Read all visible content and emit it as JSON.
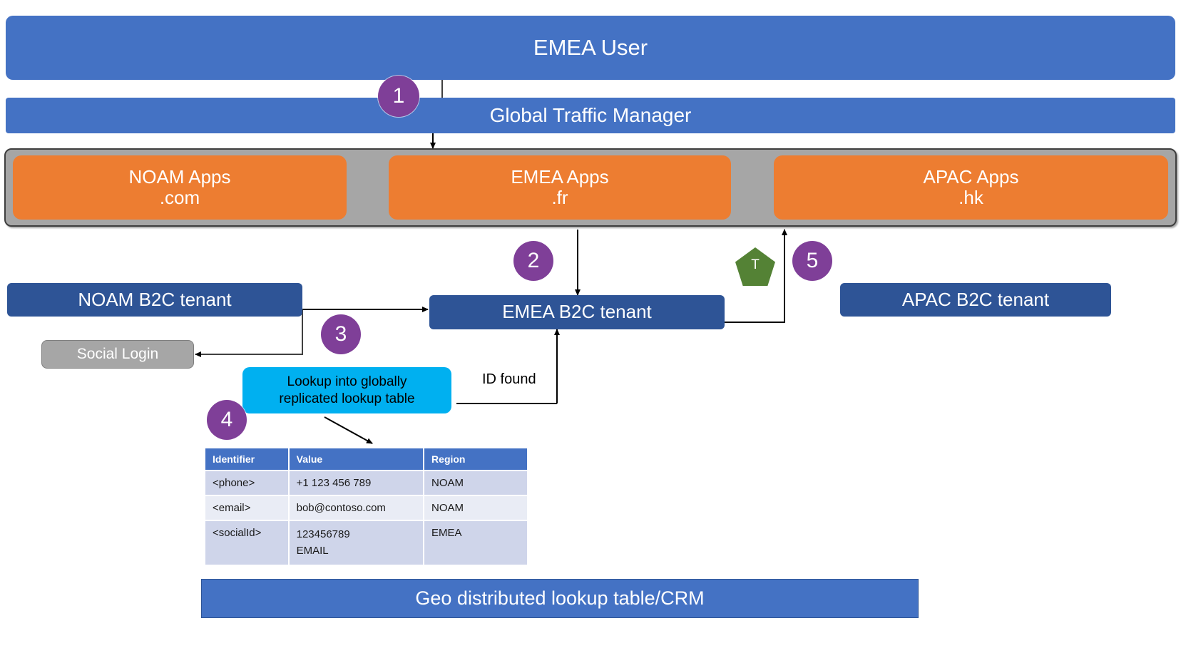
{
  "top": {
    "user_bar": "EMEA User",
    "traffic_manager_bar": "Global Traffic Manager"
  },
  "apps": [
    {
      "name": "NOAM Apps",
      "domain": ".com"
    },
    {
      "name": "EMEA Apps",
      "domain": ".fr"
    },
    {
      "name": "APAC Apps",
      "domain": ".hk"
    }
  ],
  "tenants": {
    "noam": "NOAM B2C tenant",
    "emea": "EMEA B2C tenant",
    "apac": "APAC B2C tenant"
  },
  "social_login": "Social Login",
  "lookup_callout": "Lookup into globally\nreplicated lookup table",
  "id_found_label": "ID found",
  "token_marker": "T",
  "steps": {
    "one": "1",
    "two": "2",
    "three": "3",
    "four": "4",
    "five": "5"
  },
  "lookup_table": {
    "headers": [
      "Identifier",
      "Value",
      "Region"
    ],
    "rows": [
      {
        "identifier": "<phone>",
        "value": "+1 123 456 789",
        "region": "NOAM"
      },
      {
        "identifier": "<email>",
        "value": "bob@contoso.com",
        "region": "NOAM"
      },
      {
        "identifier": "<socialId>",
        "value": "123456789\nEMAIL",
        "region": "EMEA"
      }
    ]
  },
  "bottom_bar": "Geo distributed lookup table/CRM",
  "colors": {
    "blue": "#4472C4",
    "dark_blue": "#2E5496",
    "orange": "#ED7D31",
    "grey": "#A6A6A6",
    "cyan": "#00B0F0",
    "purple": "#7F3F98",
    "green": "#548235",
    "table_header": "#4472C4",
    "row_odd": "#CFD5EA",
    "row_even": "#E9ECF5"
  }
}
